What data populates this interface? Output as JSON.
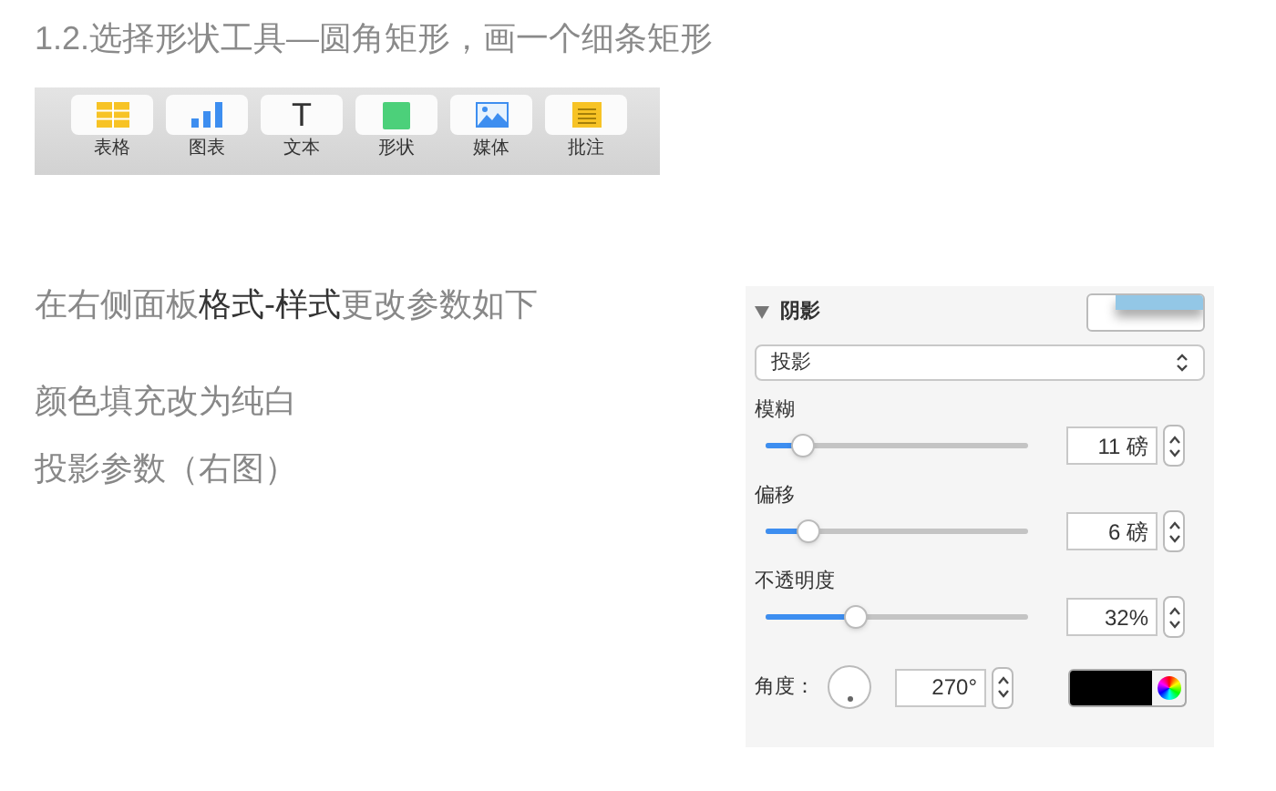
{
  "heading": "1.2.选择形状工具—圆角矩形，画一个细条矩形",
  "toolbar": [
    {
      "kind": "table",
      "label": "表格"
    },
    {
      "kind": "chart",
      "label": "图表"
    },
    {
      "kind": "text",
      "label": "文本",
      "glyph": "T"
    },
    {
      "kind": "shape",
      "label": "形状"
    },
    {
      "kind": "media",
      "label": "媒体"
    },
    {
      "kind": "comment",
      "label": "批注"
    }
  ],
  "instructions": [
    "在右侧面板**格式-样式**更改参数如下",
    "颜色填充改为纯白",
    "投影参数（右图）"
  ],
  "panel": {
    "section": {
      "title": "阴影",
      "expanded": true
    },
    "shadow_type": "投影",
    "sliders": [
      {
        "label": "模糊",
        "level": 0.14,
        "value": "11 磅"
      },
      {
        "label": "偏移",
        "level": 0.16,
        "value": "6 磅"
      },
      {
        "label": "不透明度",
        "level": 0.34,
        "value": "32%"
      }
    ],
    "angle": {
      "label": "角度：",
      "value": "270°"
    }
  }
}
